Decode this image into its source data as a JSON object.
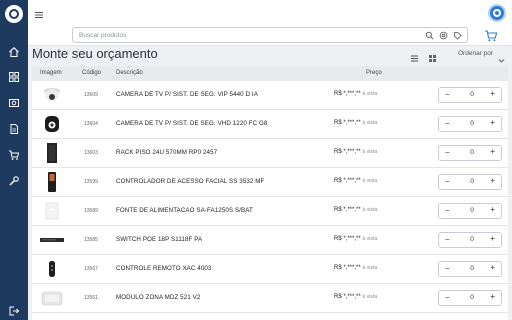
{
  "sidebar": {
    "logo": "logo-icon",
    "items": [
      {
        "icon": "home-icon"
      },
      {
        "icon": "grid-icon"
      },
      {
        "icon": "camera-icon"
      },
      {
        "icon": "document-icon"
      },
      {
        "icon": "cart-icon"
      },
      {
        "icon": "wrench-icon"
      }
    ],
    "logout_icon": "logout-icon"
  },
  "header": {
    "menu_icon": "hamburger-icon",
    "user_icon": "user-avatar-icon"
  },
  "search": {
    "placeholder": "Buscar produtos",
    "icons": [
      "search-icon",
      "at-icon",
      "tag-icon"
    ],
    "cart_icon": "cart-icon"
  },
  "page": {
    "title": "Monte seu orçamento",
    "order_label": "Ordenar por"
  },
  "table": {
    "columns": [
      "Imagem",
      "Código",
      "Descrição",
      "Preço"
    ],
    "rows": [
      {
        "code": "13609",
        "description": "CAMERA DE TV P/ SIST. DE SEG. VIP 5440 D IA",
        "price": "R$ *,***,**",
        "price_note": "à vista",
        "qty": "0"
      },
      {
        "code": "13604",
        "description": "CAMERA DE TV P/ SIST. DE SEG. VHD 1220 FC G8",
        "price": "R$ *,***,**",
        "price_note": "à vista",
        "qty": "0"
      },
      {
        "code": "13603",
        "description": "RACK PISO 24U 570MM RP0 2457",
        "price": "R$ *,***,**",
        "price_note": "à vista",
        "qty": "0"
      },
      {
        "code": "13599",
        "description": "CONTROLADOR DE ACESSO FACIAL SS 3532 MF",
        "price": "R$ *,***,**",
        "price_note": "à vista",
        "qty": "0"
      },
      {
        "code": "13589",
        "description": "FONTE DE ALIMENTACAO SA-FA1250S S/BAT",
        "price": "R$ *,***,**",
        "price_note": "à vista",
        "qty": "0"
      },
      {
        "code": "13585",
        "description": "SWITCH POE 18P S1118F PA",
        "price": "R$ *,***,**",
        "price_note": "à vista",
        "qty": "0"
      },
      {
        "code": "13567",
        "description": "CONTROLE REMOTO XAC 4003",
        "price": "R$ *,***,**",
        "price_note": "à vista",
        "qty": "0"
      },
      {
        "code": "13561",
        "description": "MODULO ZONA MDZ 521 V2",
        "price": "R$ *,***,**",
        "price_note": "à vista",
        "qty": "0"
      }
    ]
  },
  "colors": {
    "sidebar": "#1f3a5f",
    "accent": "#2e7cd6"
  }
}
